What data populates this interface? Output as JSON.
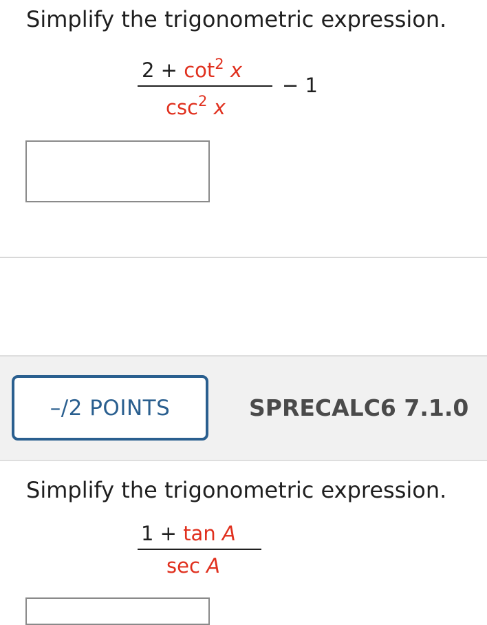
{
  "question1": {
    "instruction": "Simplify the trigonometric expression.",
    "expression": {
      "numerator_constant": "2 + ",
      "numerator_func": "cot",
      "numerator_exp": "2",
      "numerator_var": "x",
      "denominator_func": "csc",
      "denominator_exp": "2",
      "denominator_var": "x",
      "trailing": "− 1"
    },
    "answer_value": ""
  },
  "question2": {
    "points_label": "–/2 POINTS",
    "problem_code": "SPRECALC6 7.1.0",
    "instruction": "Simplify the trigonometric expression.",
    "expression": {
      "numerator_constant": "1 + ",
      "numerator_func": "tan",
      "numerator_var": "A",
      "denominator_func": "sec",
      "denominator_var": "A"
    }
  },
  "colors": {
    "math_red": "#e0301e",
    "badge_blue": "#2a5f8f",
    "header_gray": "#f1f1f1"
  }
}
